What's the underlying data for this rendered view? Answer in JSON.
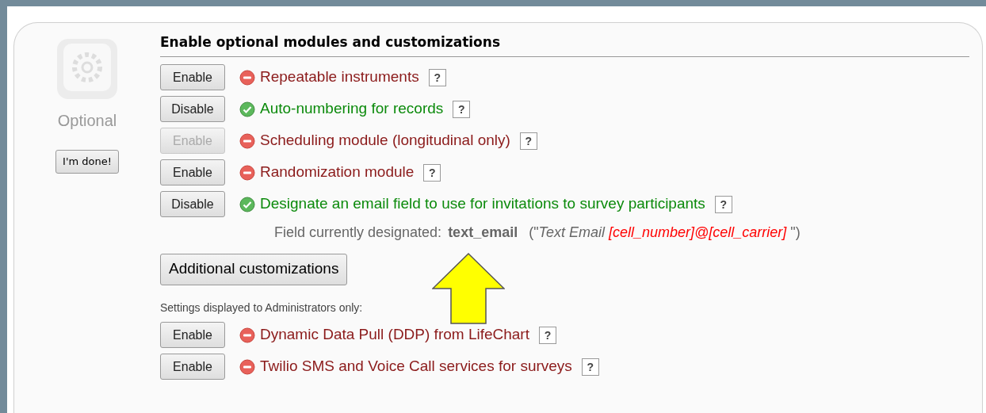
{
  "sidebar": {
    "label": "Optional",
    "done_button": "I'm done!"
  },
  "heading": "Enable optional modules and customizations",
  "modules": [
    {
      "button": "Enable",
      "enabled": false,
      "disabled": false,
      "title": "Repeatable instruments",
      "help": "?"
    },
    {
      "button": "Disable",
      "enabled": true,
      "disabled": false,
      "title": "Auto-numbering for records",
      "help": "?"
    },
    {
      "button": "Enable",
      "enabled": false,
      "disabled": true,
      "title": "Scheduling module (longitudinal only)",
      "help": "?"
    },
    {
      "button": "Enable",
      "enabled": false,
      "disabled": false,
      "title": "Randomization module",
      "help": "?"
    },
    {
      "button": "Disable",
      "enabled": true,
      "disabled": false,
      "title": "Designate an email field to use for invitations to survey participants",
      "help": "?",
      "note": {
        "label": "Field currently designated:",
        "field": "text_email",
        "open": "(\"",
        "field_label": "Text Email",
        "piping": "[cell_number]@[cell_carrier]",
        "close": "\")"
      }
    }
  ],
  "customizations_button": "Additional customizations",
  "admin_label": "Settings displayed to Administrators only:",
  "admin_modules": [
    {
      "button": "Enable",
      "enabled": false,
      "disabled": false,
      "title": "Dynamic Data Pull (DDP) from LifeChart",
      "help": "?"
    },
    {
      "button": "Enable",
      "enabled": false,
      "disabled": false,
      "title": "Twilio SMS and Voice Call services for surveys",
      "help": "?"
    }
  ]
}
